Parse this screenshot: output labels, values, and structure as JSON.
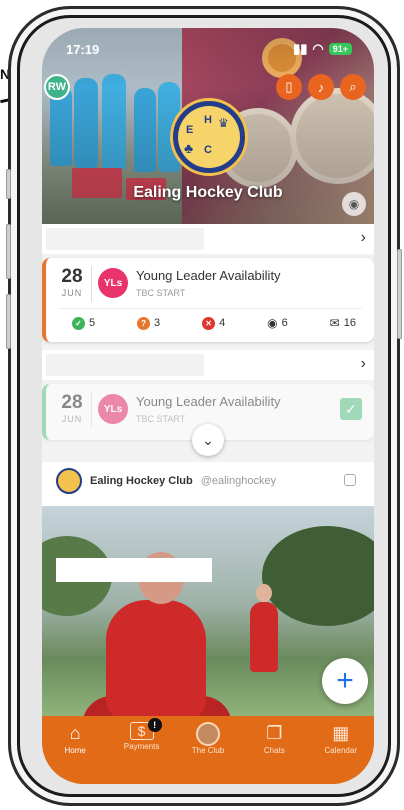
{
  "edge_label": "N",
  "status_bar": {
    "time": "17:19",
    "battery": "91+"
  },
  "header": {
    "user_initials": "RW",
    "club_name": "Ealing Hockey Club",
    "logo_letters": [
      "E",
      "H",
      "C"
    ]
  },
  "events": [
    {
      "day": "28",
      "month": "JUN",
      "badge": "YLs",
      "title": "Young Leader Availability",
      "subtitle": "TBC START",
      "stats": {
        "available": "5",
        "maybe": "3",
        "unavailable": "4",
        "views": "6",
        "messages": "16"
      }
    },
    {
      "day": "28",
      "month": "JUN",
      "badge": "YLs",
      "title": "Young Leader Availability",
      "subtitle": "TBC START"
    }
  ],
  "post": {
    "author": "Ealing Hockey Club",
    "handle": "@ealinghockey"
  },
  "tabbar": {
    "home": "Home",
    "payments": "Payments",
    "payments_badge": "!",
    "club": "The Club",
    "chats": "Chats",
    "calendar": "Calendar"
  },
  "colors": {
    "brand_orange": "#e26b17",
    "fab_plus": "#1e73e8",
    "badge_pink": "#e8336b",
    "available_green": "#3fb35c",
    "maybe_orange": "#e8772e",
    "unavailable_red": "#e0342f"
  }
}
